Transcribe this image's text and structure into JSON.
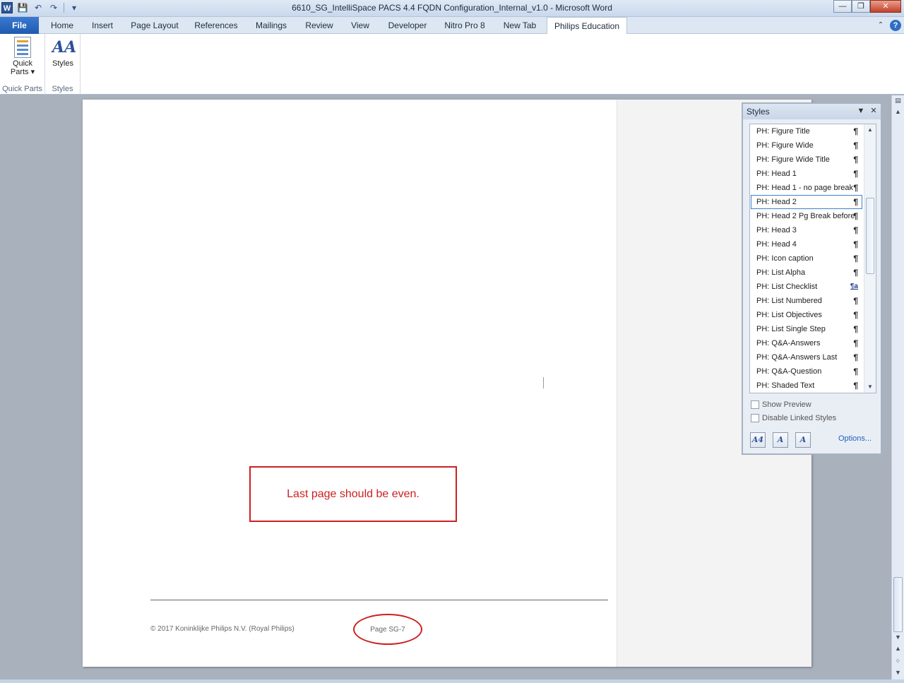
{
  "window": {
    "title": "6610_SG_IntelliSpace PACS 4.4 FQDN Configuration_Internal_v1.0  -  Microsoft Word",
    "app_icon": "W",
    "controls": {
      "minimize": "—",
      "maximize": "❐",
      "close": "✕"
    }
  },
  "qat": {
    "save_icon": "💾",
    "undo_icon": "↶",
    "redo_icon": "↷",
    "customize_icon": "▾"
  },
  "tabs": [
    {
      "label": "File"
    },
    {
      "label": "Home"
    },
    {
      "label": "Insert"
    },
    {
      "label": "Page Layout"
    },
    {
      "label": "References"
    },
    {
      "label": "Mailings"
    },
    {
      "label": "Review"
    },
    {
      "label": "View"
    },
    {
      "label": "Developer"
    },
    {
      "label": "Nitro Pro 8"
    },
    {
      "label": "New Tab"
    },
    {
      "label": "Philips Education"
    }
  ],
  "ribbon_right": {
    "collapse_icon": "⌃",
    "help_icon": "?"
  },
  "ribbon": {
    "quick_parts": {
      "button_label": "Quick\nParts ▾",
      "group_label": "Quick Parts"
    },
    "styles": {
      "button_label": "Styles",
      "icon_text": "AA",
      "group_label": "Styles"
    }
  },
  "document": {
    "note": "Last page should be even.",
    "footer_copyright": "© 2017 Koninklijke Philips N.V. (Royal Philips)",
    "footer_page": "Page SG-7"
  },
  "styles_pane": {
    "title": "Styles",
    "dropdown_icon": "▼",
    "close_icon": "✕",
    "items": [
      {
        "label": "PH: Figure Title",
        "mark": "¶"
      },
      {
        "label": "PH: Figure Wide",
        "mark": "¶"
      },
      {
        "label": "PH: Figure Wide Title",
        "mark": "¶"
      },
      {
        "label": "PH: Head 1",
        "mark": "¶"
      },
      {
        "label": "PH: Head 1 - no page break",
        "mark": "¶"
      },
      {
        "label": "PH: Head 2",
        "mark": "¶"
      },
      {
        "label": "PH: Head 2 Pg Break before",
        "mark": "¶"
      },
      {
        "label": "PH: Head 3",
        "mark": "¶"
      },
      {
        "label": "PH: Head 4",
        "mark": "¶"
      },
      {
        "label": "PH: Icon caption",
        "mark": "¶"
      },
      {
        "label": "PH: List Alpha",
        "mark": "¶"
      },
      {
        "label": "PH: List Checklist",
        "mark": "¶a"
      },
      {
        "label": "PH: List Numbered",
        "mark": "¶"
      },
      {
        "label": "PH: List Objectives",
        "mark": "¶"
      },
      {
        "label": "PH: List Single Step",
        "mark": "¶"
      },
      {
        "label": "PH: Q&A-Answers",
        "mark": "¶"
      },
      {
        "label": "PH: Q&A-Answers Last",
        "mark": "¶"
      },
      {
        "label": "PH: Q&A-Question",
        "mark": "¶"
      },
      {
        "label": "PH: Shaded Text",
        "mark": "¶"
      }
    ],
    "selected": "PH: Head 2",
    "show_preview": "Show Preview",
    "disable_linked": "Disable Linked Styles",
    "options": "Options...",
    "new_style_icon": "A4",
    "style_inspector_icon": "A",
    "manage_styles_icon": "A"
  },
  "scrollbar": {
    "up": "▲",
    "down": "▼",
    "prev_page": "▲",
    "select_browse": "○",
    "next_page": "▼"
  },
  "colors": {
    "accent": "#2b5797",
    "annotation_red": "#cc2020",
    "file_tab": "#2a6ac2"
  }
}
